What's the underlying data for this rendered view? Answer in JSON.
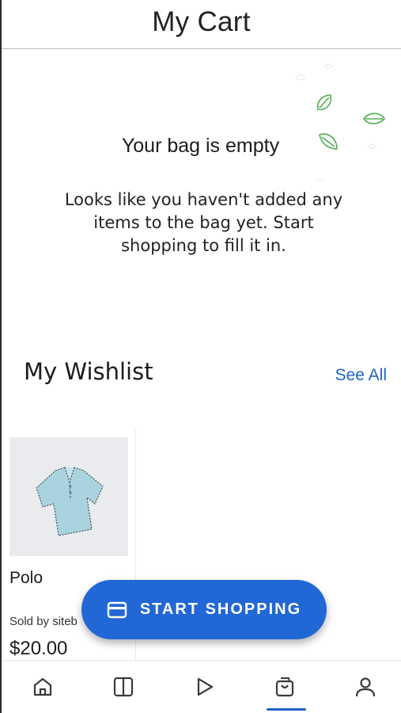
{
  "header": {
    "title": "My Cart"
  },
  "empty_state": {
    "title": "Your bag is empty",
    "message_line1": "Looks like you haven't added any",
    "message_line2": "items to the bag yet. Start",
    "message_line3": "shopping to fill it in."
  },
  "wishlist": {
    "title": "My Wishlist",
    "see_all": "See All",
    "items": [
      {
        "name": "Polo",
        "seller": "Sold by siteb",
        "price": "$20.00"
      }
    ]
  },
  "fab": {
    "label": "START SHOPPING",
    "icon": "credit-card-icon"
  },
  "bottom_nav": {
    "items": [
      {
        "icon": "home-icon"
      },
      {
        "icon": "columns-icon"
      },
      {
        "icon": "play-icon"
      },
      {
        "icon": "shopping-bag-icon",
        "active": true
      },
      {
        "icon": "user-icon"
      }
    ]
  },
  "colors": {
    "accent": "#2167d6",
    "link": "#1e63c6",
    "leaf": "#4caf50"
  }
}
